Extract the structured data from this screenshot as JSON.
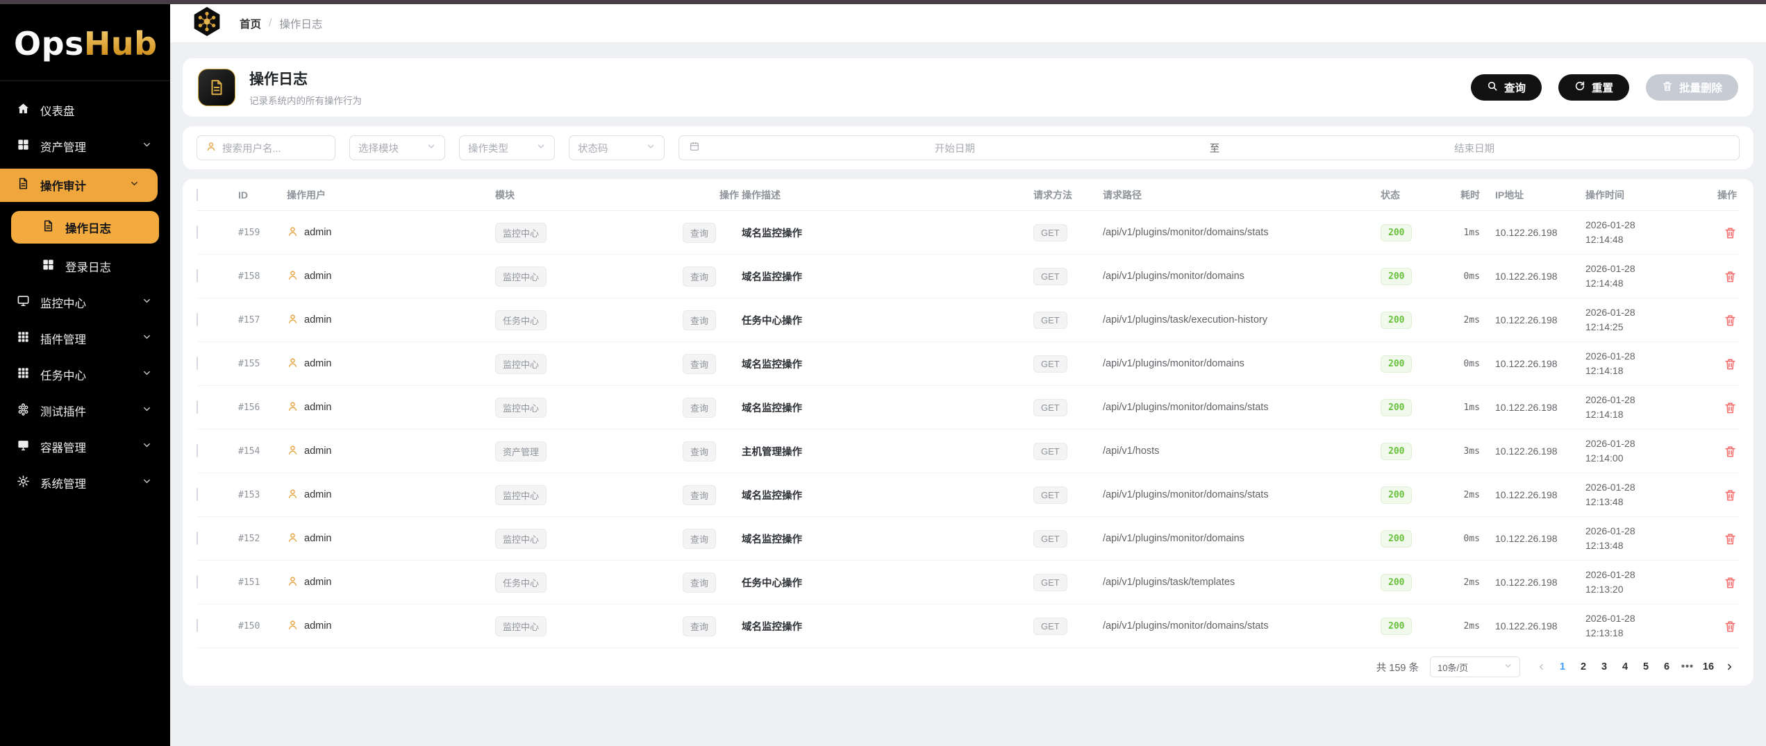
{
  "colors": {
    "accent": "#efa73d",
    "success": "#67c23a",
    "danger": "#f56c6c",
    "link": "#409eff",
    "top_strip": "#483e47"
  },
  "sidebar": {
    "logo_ops": "Ops",
    "logo_hub": "Hub",
    "menu": [
      {
        "label": "仪表盘",
        "icon": "home-icon",
        "type": "item",
        "chevron": false,
        "state": "normal"
      },
      {
        "label": "资产管理",
        "icon": "grid2-icon",
        "type": "item",
        "chevron": true,
        "state": "normal"
      },
      {
        "label": "操作审计",
        "icon": "document-icon",
        "type": "item",
        "chevron": true,
        "state": "parent-active"
      },
      {
        "label": "操作日志",
        "icon": "document-icon",
        "type": "subitem",
        "chevron": false,
        "state": "sub-active"
      },
      {
        "label": "登录日志",
        "icon": "grid2-icon",
        "type": "subitem",
        "chevron": false,
        "state": "normal"
      },
      {
        "label": "监控中心",
        "icon": "monitor-icon",
        "type": "item",
        "chevron": true,
        "state": "normal"
      },
      {
        "label": "插件管理",
        "icon": "grid3-icon",
        "type": "item",
        "chevron": true,
        "state": "normal"
      },
      {
        "label": "任务中心",
        "icon": "grid3-icon",
        "type": "item",
        "chevron": true,
        "state": "normal"
      },
      {
        "label": "测试插件",
        "icon": "molecule-icon",
        "type": "item",
        "chevron": true,
        "state": "normal"
      },
      {
        "label": "容器管理",
        "icon": "display-icon",
        "type": "item",
        "chevron": true,
        "state": "normal"
      },
      {
        "label": "系统管理",
        "icon": "gear-icon",
        "type": "item",
        "chevron": true,
        "state": "normal"
      }
    ]
  },
  "topbar": {
    "breadcrumb_home": "首页",
    "breadcrumb_sep": "/",
    "breadcrumb_current": "操作日志"
  },
  "header": {
    "title": "操作日志",
    "subtitle": "记录系统内的所有操作行为",
    "query_label": "查询",
    "reset_label": "重置",
    "batch_delete_label": "批量删除"
  },
  "filters": {
    "username_placeholder": "搜索用户名...",
    "module_placeholder": "选择模块",
    "action_placeholder": "操作类型",
    "status_placeholder": "状态码",
    "start_placeholder": "开始日期",
    "range_separator": "至",
    "end_placeholder": "结束日期"
  },
  "table": {
    "headers": [
      "ID",
      "操作用户",
      "模块",
      "操作",
      "操作描述",
      "请求方法",
      "请求路径",
      "状态",
      "耗时",
      "IP地址",
      "操作时间",
      "操作"
    ],
    "rows": [
      {
        "id": "#159",
        "user": "admin",
        "module": "监控中心",
        "action": "查询",
        "desc": "域名监控操作",
        "method": "GET",
        "path": "/api/v1/plugins/monitor/domains/stats",
        "status": "200",
        "duration": "1ms",
        "ip": "10.122.26.198",
        "date": "2026-01-28",
        "time": "12:14:48"
      },
      {
        "id": "#158",
        "user": "admin",
        "module": "监控中心",
        "action": "查询",
        "desc": "域名监控操作",
        "method": "GET",
        "path": "/api/v1/plugins/monitor/domains",
        "status": "200",
        "duration": "0ms",
        "ip": "10.122.26.198",
        "date": "2026-01-28",
        "time": "12:14:48"
      },
      {
        "id": "#157",
        "user": "admin",
        "module": "任务中心",
        "action": "查询",
        "desc": "任务中心操作",
        "method": "GET",
        "path": "/api/v1/plugins/task/execution-history",
        "status": "200",
        "duration": "2ms",
        "ip": "10.122.26.198",
        "date": "2026-01-28",
        "time": "12:14:25"
      },
      {
        "id": "#155",
        "user": "admin",
        "module": "监控中心",
        "action": "查询",
        "desc": "域名监控操作",
        "method": "GET",
        "path": "/api/v1/plugins/monitor/domains",
        "status": "200",
        "duration": "0ms",
        "ip": "10.122.26.198",
        "date": "2026-01-28",
        "time": "12:14:18"
      },
      {
        "id": "#156",
        "user": "admin",
        "module": "监控中心",
        "action": "查询",
        "desc": "域名监控操作",
        "method": "GET",
        "path": "/api/v1/plugins/monitor/domains/stats",
        "status": "200",
        "duration": "1ms",
        "ip": "10.122.26.198",
        "date": "2026-01-28",
        "time": "12:14:18"
      },
      {
        "id": "#154",
        "user": "admin",
        "module": "资产管理",
        "action": "查询",
        "desc": "主机管理操作",
        "method": "GET",
        "path": "/api/v1/hosts",
        "status": "200",
        "duration": "3ms",
        "ip": "10.122.26.198",
        "date": "2026-01-28",
        "time": "12:14:00"
      },
      {
        "id": "#153",
        "user": "admin",
        "module": "监控中心",
        "action": "查询",
        "desc": "域名监控操作",
        "method": "GET",
        "path": "/api/v1/plugins/monitor/domains/stats",
        "status": "200",
        "duration": "2ms",
        "ip": "10.122.26.198",
        "date": "2026-01-28",
        "time": "12:13:48"
      },
      {
        "id": "#152",
        "user": "admin",
        "module": "监控中心",
        "action": "查询",
        "desc": "域名监控操作",
        "method": "GET",
        "path": "/api/v1/plugins/monitor/domains",
        "status": "200",
        "duration": "0ms",
        "ip": "10.122.26.198",
        "date": "2026-01-28",
        "time": "12:13:48"
      },
      {
        "id": "#151",
        "user": "admin",
        "module": "任务中心",
        "action": "查询",
        "desc": "任务中心操作",
        "method": "GET",
        "path": "/api/v1/plugins/task/templates",
        "status": "200",
        "duration": "2ms",
        "ip": "10.122.26.198",
        "date": "2026-01-28",
        "time": "12:13:20"
      },
      {
        "id": "#150",
        "user": "admin",
        "module": "监控中心",
        "action": "查询",
        "desc": "域名监控操作",
        "method": "GET",
        "path": "/api/v1/plugins/monitor/domains/stats",
        "status": "200",
        "duration": "2ms",
        "ip": "10.122.26.198",
        "date": "2026-01-28",
        "time": "12:13:18"
      }
    ]
  },
  "pagination": {
    "total": "共 159 条",
    "page_size": "10条/页",
    "pages": [
      "1",
      "2",
      "3",
      "4",
      "5",
      "6",
      "•••",
      "16"
    ],
    "active_page": "1"
  }
}
